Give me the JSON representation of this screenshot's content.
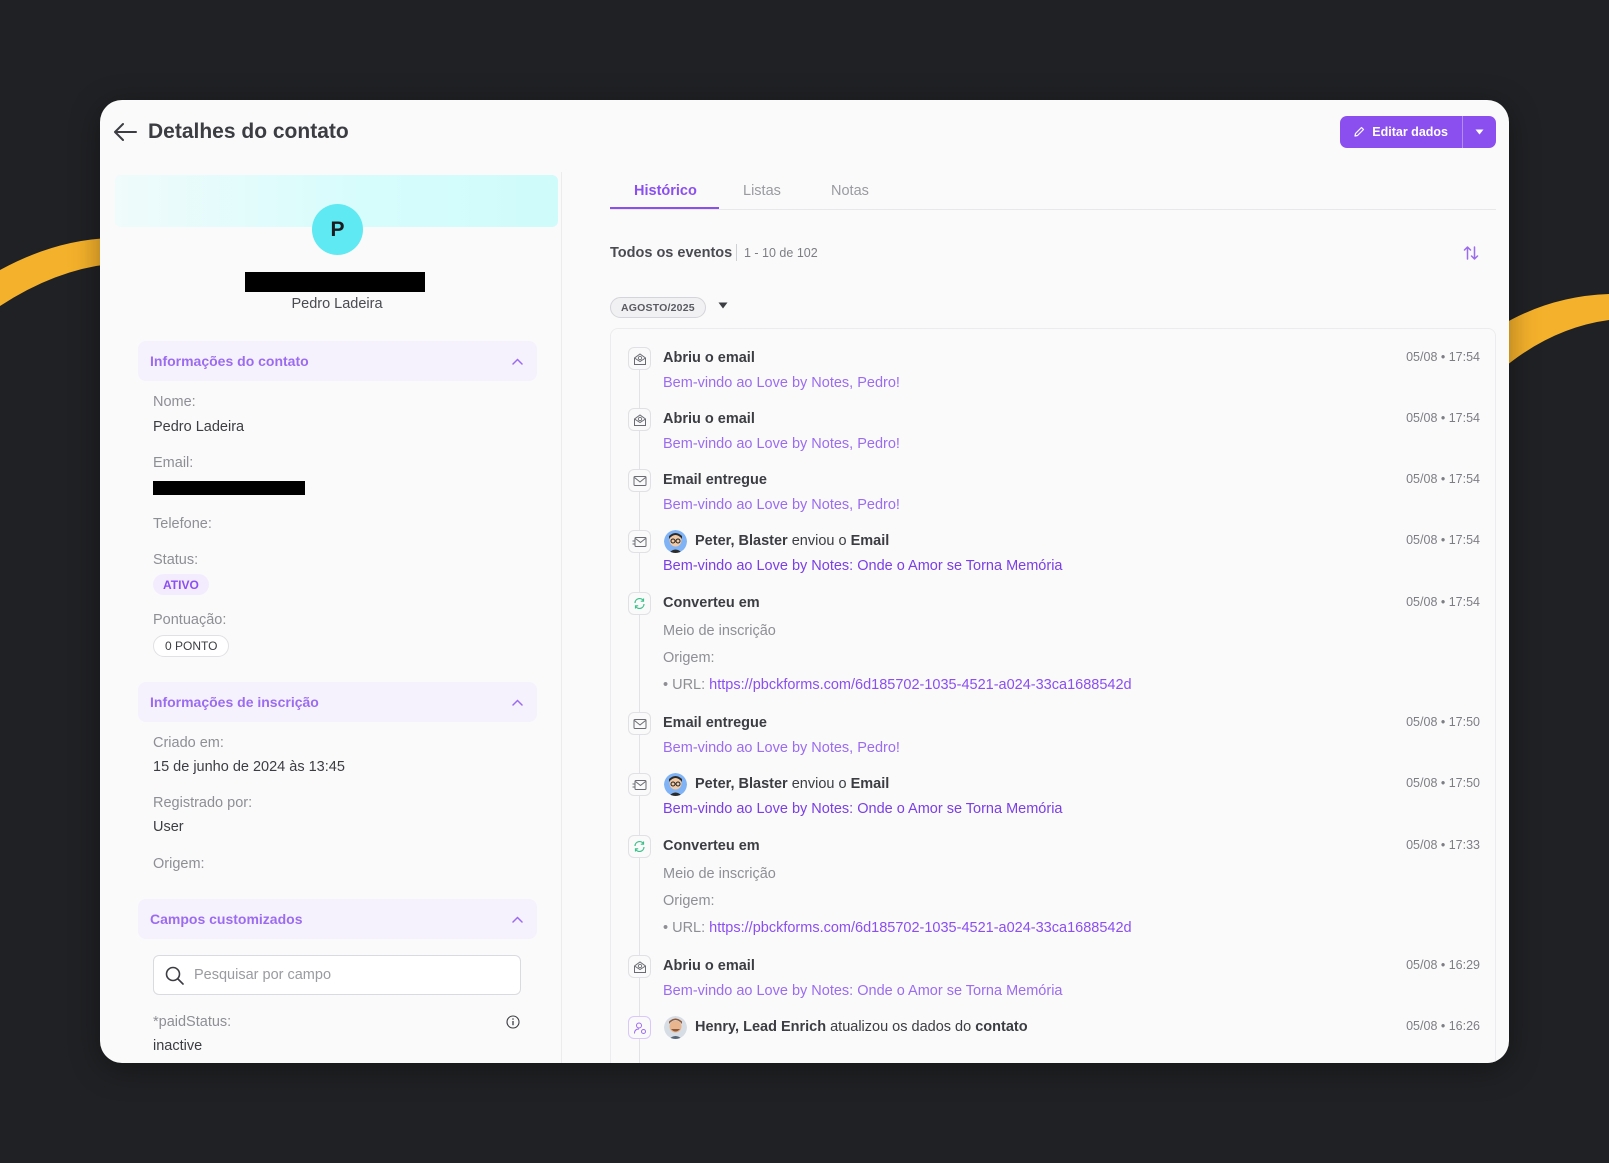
{
  "header": {
    "title": "Detalhes do contato",
    "edit_label": "Editar dados"
  },
  "contact": {
    "avatar_letter": "P",
    "name": "Pedro Ladeira",
    "sections": {
      "contact_info": "Informações do contato",
      "subscription_info": "Informações de inscrição",
      "custom_fields": "Campos customizados"
    },
    "fields": {
      "name_label": "Nome:",
      "name_value": "Pedro Ladeira",
      "email_label": "Email:",
      "phone_label": "Telefone:",
      "status_label": "Status:",
      "status_value": "ATIVO",
      "score_label": "Pontuação:",
      "score_value": "0 PONTO",
      "created_label": "Criado em:",
      "created_value": "15 de junho de 2024 às 13:45",
      "registered_label": "Registrado por:",
      "registered_value": "User",
      "origin_label": "Origem:",
      "custom_search_placeholder": "Pesquisar por campo",
      "paid_status_label": "*paidStatus:",
      "paid_status_value": "inactive"
    }
  },
  "tabs": [
    "Histórico",
    "Listas",
    "Notas"
  ],
  "events_header": {
    "title": "Todos os eventos",
    "count": "1 - 10 de 102",
    "month": "AGOSTO/2025"
  },
  "events": [
    {
      "title": "Abriu o email",
      "sub": "Bem-vindo ao Love by Notes, Pedro!",
      "time": "05/08 • 17:54"
    },
    {
      "title": "Abriu o email",
      "sub": "Bem-vindo ao Love by Notes, Pedro!",
      "time": "05/08 • 17:54"
    },
    {
      "title": "Email entregue",
      "sub": "Bem-vindo ao Love by Notes, Pedro!",
      "time": "05/08 • 17:54"
    },
    {
      "actor": "Peter, Blaster",
      "action": "enviou o",
      "object": "Email",
      "sub": "Bem-vindo ao Love by Notes: Onde o Amor se Torna Memória",
      "time": "05/08 • 17:54"
    },
    {
      "title": "Converteu em",
      "meio": "Meio de inscrição",
      "origem": "Origem:",
      "url_prefix": "• URL:",
      "url": "https://pbckforms.com/6d185702-1035-4521-a024-33ca1688542d",
      "time": "05/08 • 17:54"
    },
    {
      "title": "Email entregue",
      "sub": "Bem-vindo ao Love by Notes, Pedro!",
      "time": "05/08 • 17:50"
    },
    {
      "actor": "Peter, Blaster",
      "action": "enviou o",
      "object": "Email",
      "sub": "Bem-vindo ao Love by Notes: Onde o Amor se Torna Memória",
      "time": "05/08 • 17:50"
    },
    {
      "title": "Converteu em",
      "meio": "Meio de inscrição",
      "origem": "Origem:",
      "url_prefix": "• URL:",
      "url": "https://pbckforms.com/6d185702-1035-4521-a024-33ca1688542d",
      "time": "05/08 • 17:33"
    },
    {
      "title": "Abriu o email",
      "sub": "Bem-vindo ao Love by Notes: Onde o Amor se Torna Memória",
      "time": "05/08 • 16:29"
    },
    {
      "actor": "Henry, Lead Enrich",
      "action": "atualizou os dados do",
      "object": "contato",
      "time": "05/08 • 16:26"
    }
  ],
  "colors": {
    "accent": "#8b4ff0",
    "background": "#202124",
    "swoosh": "#f4b12b",
    "avatar": "#5fe9f2"
  }
}
